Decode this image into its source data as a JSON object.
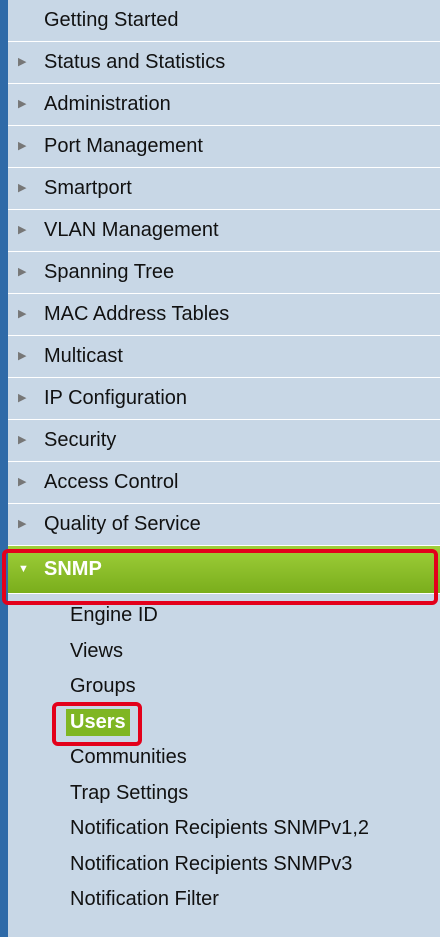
{
  "nav": {
    "items": [
      {
        "label": "Getting Started",
        "expandable": false
      },
      {
        "label": "Status and Statistics",
        "expandable": true
      },
      {
        "label": "Administration",
        "expandable": true
      },
      {
        "label": "Port Management",
        "expandable": true
      },
      {
        "label": "Smartport",
        "expandable": true
      },
      {
        "label": "VLAN Management",
        "expandable": true
      },
      {
        "label": "Spanning Tree",
        "expandable": true
      },
      {
        "label": "MAC Address Tables",
        "expandable": true
      },
      {
        "label": "Multicast",
        "expandable": true
      },
      {
        "label": "IP Configuration",
        "expandable": true
      },
      {
        "label": "Security",
        "expandable": true
      },
      {
        "label": "Access Control",
        "expandable": true
      },
      {
        "label": "Quality of Service",
        "expandable": true
      }
    ],
    "active": {
      "label": "SNMP",
      "expanded": true,
      "subitems": [
        {
          "label": "Engine ID"
        },
        {
          "label": "Views"
        },
        {
          "label": "Groups"
        },
        {
          "label": "Users",
          "selected": true
        },
        {
          "label": "Communities"
        },
        {
          "label": "Trap Settings"
        },
        {
          "label": "Notification Recipients SNMPv1,2"
        },
        {
          "label": "Notification Recipients SNMPv3"
        },
        {
          "label": "Notification Filter"
        }
      ]
    }
  },
  "icons": {
    "collapsed": "triangle-right-icon",
    "expanded": "triangle-down-icon"
  },
  "colors": {
    "nav_bg": "#c8d7e6",
    "nav_border": "#2e6aa8",
    "active_bg": "#8cc028",
    "selected_bg": "#7fb623",
    "annotation": "#e3001b"
  }
}
